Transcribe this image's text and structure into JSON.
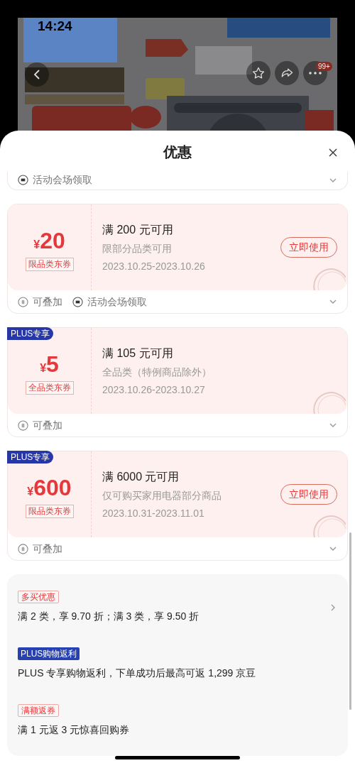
{
  "status_bar": {
    "time": "14:24"
  },
  "product_nav": {
    "more_badge": "99+"
  },
  "sheet": {
    "title": "优惠",
    "top_card_footer": [
      {
        "kind": "venue",
        "label": "活动会场领取"
      }
    ],
    "coupons": [
      {
        "currency": "¥",
        "amount": "20",
        "tag": "限品类东券",
        "title": "满 200 元可用",
        "scope": "限部分品类可用",
        "dates": "2023.10.25-2023.10.26",
        "action": "立即使用",
        "footer": [
          {
            "kind": "stackable",
            "label": "可叠加"
          },
          {
            "kind": "venue",
            "label": "活动会场领取"
          }
        ]
      },
      {
        "plus_badge": "PLUS专享",
        "currency": "¥",
        "amount": "5",
        "tag": "全品类东券",
        "title": "满 105 元可用",
        "scope": "全品类（特例商品除外）",
        "dates": "2023.10.26-2023.10.27",
        "footer": [
          {
            "kind": "stackable",
            "label": "可叠加"
          }
        ]
      },
      {
        "plus_badge": "PLUS专享",
        "currency": "¥",
        "amount": "600",
        "tag": "限品类东券",
        "title": "满 6000 元可用",
        "scope": "仅可购买家用电器部分商品",
        "dates": "2023.10.31-2023.11.01",
        "action": "立即使用",
        "footer": [
          {
            "kind": "stackable",
            "label": "可叠加"
          }
        ]
      }
    ],
    "promotions": [
      {
        "kind": "outline",
        "tag": "多买优惠",
        "text": "满 2 类，享 9.70 折；满 3 类，享 9.50 折",
        "arrow": true
      },
      {
        "kind": "solid",
        "tag": "PLUS购物返利",
        "text": "PLUS 专享购物返利，下单成功后最高可返 1,299 京豆",
        "arrow": false
      },
      {
        "kind": "outline",
        "tag": "满额返券",
        "text": "满 1 元返 3 元惊喜回购券",
        "arrow": false
      }
    ]
  }
}
